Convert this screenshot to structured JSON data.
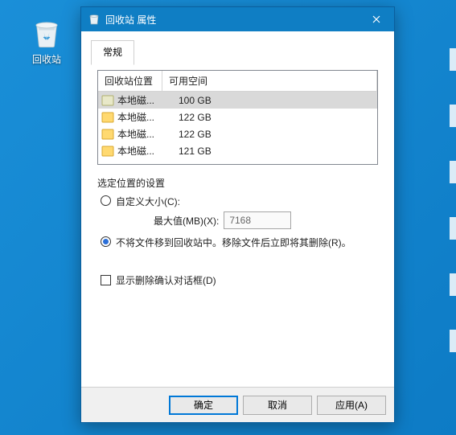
{
  "desktop": {
    "recycle_bin_label": "回收站"
  },
  "dialog": {
    "title": "回收站 属性",
    "tab_general": "常规",
    "list": {
      "header_location": "回收站位置",
      "header_space": "可用空间",
      "rows": [
        {
          "loc": "本地磁...",
          "size": "100 GB"
        },
        {
          "loc": "本地磁...",
          "size": "122 GB"
        },
        {
          "loc": "本地磁...",
          "size": "122 GB"
        },
        {
          "loc": "本地磁...",
          "size": "121 GB"
        }
      ]
    },
    "group_title": "选定位置的设置",
    "opt_custom": "自定义大小(C):",
    "max_label": "最大值(MB)(X):",
    "max_value": "7168",
    "opt_no_recycle": "不将文件移到回收站中。移除文件后立即将其删除(R)。",
    "chk_confirm": "显示删除确认对话框(D)",
    "btn_ok": "确定",
    "btn_cancel": "取消",
    "btn_apply": "应用(A)"
  }
}
